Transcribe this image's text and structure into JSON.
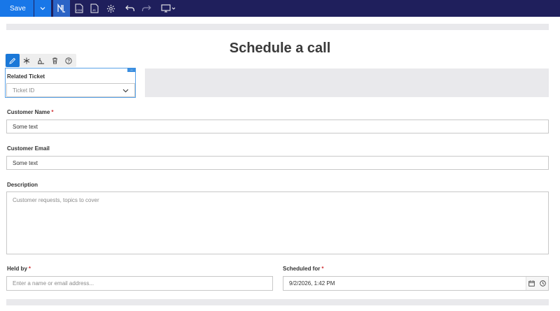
{
  "toolbar": {
    "save_label": "Save",
    "icons": [
      "save-dropdown-icon",
      "form-icon",
      "css-file-icon",
      "js-file-icon",
      "settings-gear-icon",
      "undo-icon",
      "redo-icon",
      "device-preview-icon"
    ]
  },
  "form": {
    "title": "Schedule a call",
    "related_ticket": {
      "label": "Related Ticket",
      "placeholder": "Ticket ID"
    },
    "customer_name": {
      "label": "Customer Name",
      "required_mark": "*",
      "value": "Some text"
    },
    "customer_email": {
      "label": "Customer Email",
      "value": "Some text"
    },
    "description": {
      "label": "Description",
      "placeholder": "Customer requests, topics to cover"
    },
    "held_by": {
      "label": "Held by",
      "required_mark": "*",
      "placeholder": "Enter a name or email address..."
    },
    "scheduled_for": {
      "label": "Scheduled for",
      "required_mark": "*",
      "value": "9/2/2026, 1:42 PM"
    }
  },
  "colors": {
    "topbar": "#1f1f5c",
    "accent": "#1877e8",
    "required": "#d13438"
  }
}
